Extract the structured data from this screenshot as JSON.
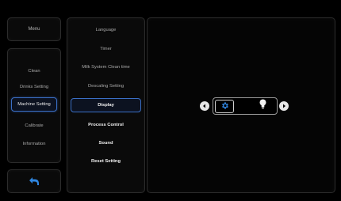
{
  "left_menu": {
    "top_label": "Menu",
    "items": [
      {
        "label": "Clean"
      },
      {
        "label": "Drinks Setting"
      },
      {
        "label": "Machine Setting"
      },
      {
        "label": "Calibrate"
      },
      {
        "label": "Information"
      }
    ]
  },
  "sub_menu": {
    "items": [
      {
        "label": "Language"
      },
      {
        "label": "Timer"
      },
      {
        "label": "Milk System Clean time"
      },
      {
        "label": "Descaling Setting"
      },
      {
        "label": "Display"
      },
      {
        "label": "Process Control"
      },
      {
        "label": "Sound"
      },
      {
        "label": "Reset Setting"
      }
    ]
  },
  "display_control": {
    "left_arrow_icon": "chevron-left-icon",
    "right_arrow_icon": "chevron-right-icon",
    "options": [
      "gear-icon",
      "lightbulb-icon"
    ]
  },
  "colors": {
    "accent": "#3a6fc6",
    "gear": "#2e7fd6"
  }
}
